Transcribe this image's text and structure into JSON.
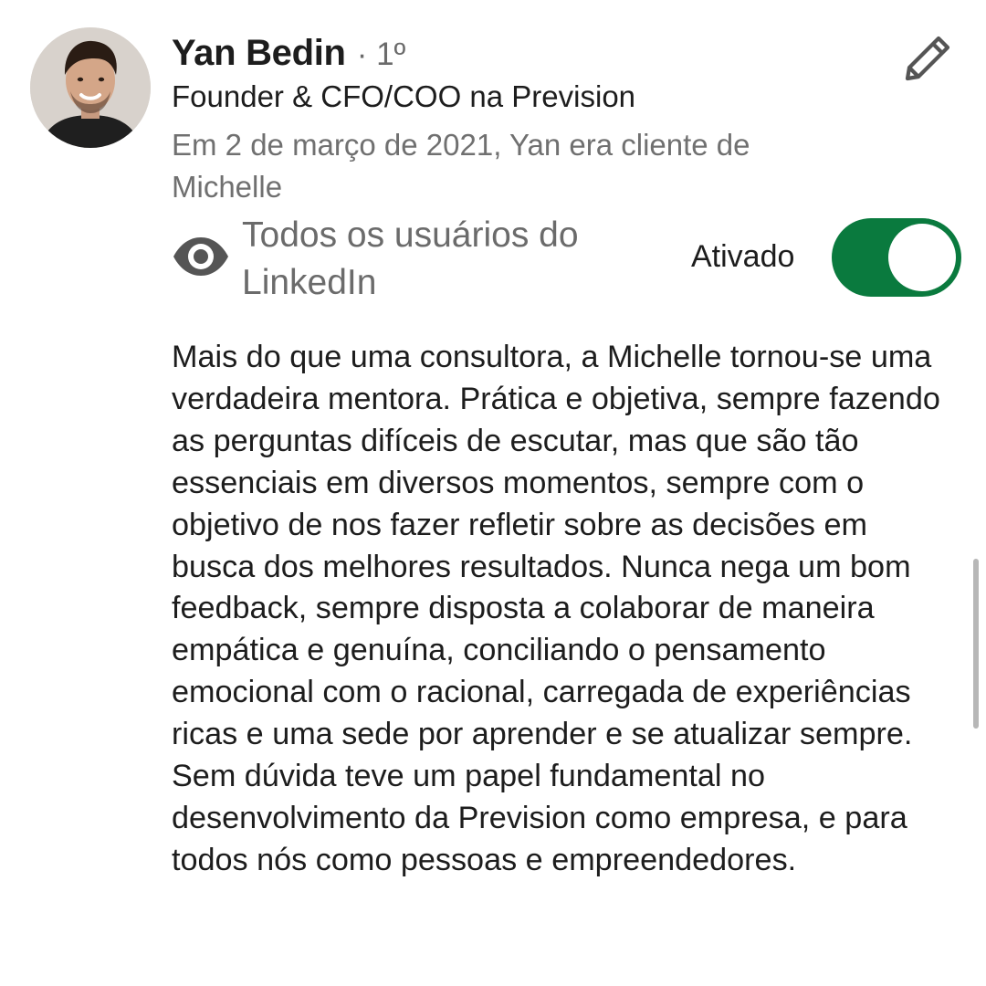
{
  "recommender": {
    "name": "Yan Bedin",
    "degree": "· 1º",
    "headline": "Founder & CFO/COO na Prevision",
    "relationship": "Em 2 de março de 2021, Yan era cliente de Michelle"
  },
  "visibility": {
    "icon": "eye-icon",
    "audience": "Todos os usuários do LinkedIn",
    "status_label": "Ativado",
    "toggle_on": true,
    "accent_color": "#0a7a3e"
  },
  "actions": {
    "edit_icon": "pencil-icon"
  },
  "recommendation": {
    "text": "Mais do que uma consultora, a Michelle tornou-se uma verdadeira mentora. Prática e objetiva, sempre fazendo as perguntas difíceis de escutar, mas que são tão essenciais em diversos momentos, sempre com o objetivo de nos fazer refletir sobre as decisões em busca dos melhores resultados. Nunca nega um bom feedback, sempre disposta a colaborar de maneira empática e genuína, conciliando o pensamento emocional com o racional, carregada de experiências ricas e uma sede por aprender e se atualizar sempre. Sem dúvida teve um papel fundamental no desenvolvimento da Prevision como empresa, e para todos nós como pessoas e empreendedores."
  }
}
